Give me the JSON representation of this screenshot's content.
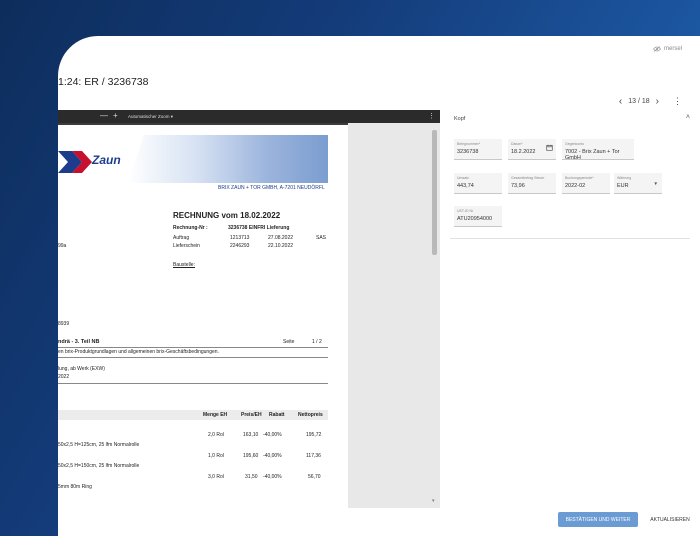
{
  "header": {
    "user": "mersel",
    "title": "1:24: ER / 3236738",
    "pagination": "13 / 18",
    "prev_icon": "‹",
    "next_icon": "›",
    "more_icon": "⋮"
  },
  "viewer": {
    "zoom_minus": "—",
    "zoom_plus": "+",
    "zoom_select": "Automatischer Zoom ▾",
    "menu_icon": "⋮",
    "scroll_down": "▾"
  },
  "document": {
    "logo_text": "Zaun",
    "company_line": "BRIX ZAUN + TOR GMBH, A-7201 NEUDÖRFL",
    "heading": "RECHNUNG  vom  18.02.2022",
    "rechnung_label": "Rechnung-Nr :",
    "rechnung_value": "3236738 EINFRI Lieferung",
    "auftrag_label": "Auftrag",
    "auftrag_nr": "1213713",
    "auftrag_date": "27.08.2022",
    "auftrag_code": "SAS",
    "lieferschein_label": "Lieferschein",
    "lieferschein_nr": "2246293",
    "lieferschein_date": "22.10.2022",
    "address_fragment": "99a",
    "baustelle": "Baustelle:",
    "number_fragment": "8939",
    "customer_name": "ndrä - 3. Teil NB",
    "seite_label": "Seite",
    "seite_value": "1 / 2",
    "terms": "en brix-Produktgrundlagen und allgemeinen brix-Geschäftsbedingungen.",
    "delivery": "lung, ab Werk (EXW)",
    "year": "2022",
    "col_menge": "Menge EH",
    "col_preis": "Preis/EH",
    "col_rabatt": "Rabatt",
    "col_netto": "Nettopreis",
    "rows": [
      {
        "desc": "50x2,5 H=125cm, 25 lfm Normalrolle",
        "menge": "2,0 Rol",
        "preis": "163,10",
        "rabatt": "-40,00%",
        "netto": "195,72"
      },
      {
        "desc": "50x2,5 H=150cm, 25 lfm Normalrolle",
        "menge": "1,0 Rol",
        "preis": "195,60",
        "rabatt": "-40,00%",
        "netto": "117,36"
      },
      {
        "desc": "5mm 80m Ring",
        "menge": "3,0 Rol",
        "preis": "31,50",
        "rabatt": "-40,00%",
        "netto": "56,70"
      }
    ]
  },
  "panel": {
    "section_title": "Kopf",
    "collapse_icon": "˄",
    "fields": {
      "belegnummer": {
        "label": "Belegnummer*",
        "value": "3236738"
      },
      "datum": {
        "label": "Datum*",
        "value": "18.2.2022"
      },
      "gegenkonto": {
        "label": "Gegenkonto",
        "value": "7002 - Brix Zaun + Tor GmbH"
      },
      "umsatz": {
        "label": "Umsatz",
        "value": "443,74"
      },
      "steuer": {
        "label": "Gesamtbetrag Steuer",
        "value": "73,96"
      },
      "buchungsperiode": {
        "label": "Buchungsperiode*",
        "value": "2022-02"
      },
      "waehrung": {
        "label": "Währung",
        "value": "EUR"
      },
      "ustid": {
        "label": "UST-ID Nr",
        "value": "ATU20954000"
      }
    }
  },
  "footer": {
    "confirm": "BESTÄTIGEN UND WEITER",
    "refresh": "AKTUALISIEREN"
  },
  "colors": {
    "accent": "#6a9bd3",
    "brand": "#1d3c8c",
    "background": "#143c7a"
  }
}
